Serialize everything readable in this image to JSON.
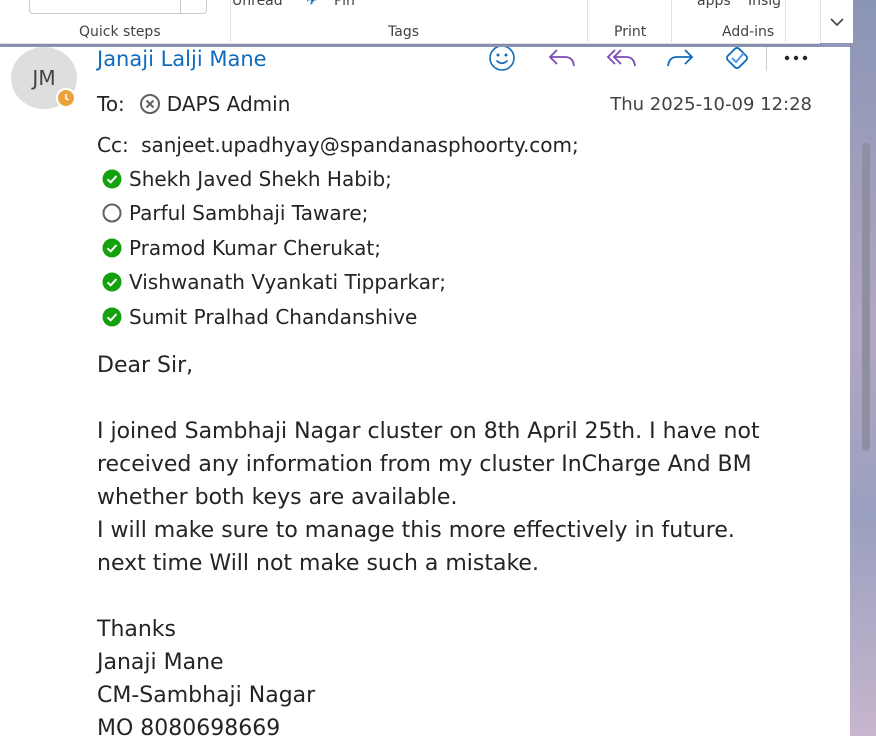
{
  "ribbon": {
    "groups": {
      "quick_steps": "Quick steps",
      "tags": "Tags",
      "print": "Print",
      "addins": "Add-ins"
    },
    "fragments": {
      "unread": "Unread",
      "pin": "Pin",
      "apps": "apps",
      "insights": "Insig"
    },
    "collapse_icon": "chevron-down-icon"
  },
  "message": {
    "avatar_initials": "JM",
    "presence": "away",
    "sender": "Janaji Lalji Mane",
    "to_label": "To:",
    "to_recipient": "DAPS Admin",
    "date": "Thu 2025-10-09 12:28",
    "cc_label": "Cc:",
    "cc_first": "sanjeet.upadhyay@spandanasphoorty.com;",
    "cc_recipients": [
      {
        "name": "Shekh Javed Shekh Habib;",
        "status": "available"
      },
      {
        "name": "Parful Sambhaji Taware;",
        "status": "offline"
      },
      {
        "name": "Pramod Kumar Cherukat;",
        "status": "available"
      },
      {
        "name": "Vishwanath Vyankati Tipparkar;",
        "status": "available"
      },
      {
        "name": "Sumit Pralhad Chandanshive",
        "status": "available"
      }
    ],
    "actions": [
      "emoji-icon",
      "reply-icon",
      "reply-all-icon",
      "forward-icon",
      "teams-share-icon",
      "more-icon"
    ]
  },
  "body": {
    "greeting": "Dear Sir,",
    "lines": [
      "I joined Sambhaji Nagar cluster on 8th April 25th. I have not",
      "received any information from my cluster InCharge And BM",
      "whether both keys are available.",
      "I will make sure to manage this more effectively in future.",
      "next time Will not make such a mistake."
    ],
    "signature": [
      "Thanks",
      "Janaji Mane",
      "CM-Sambhaji Nagar",
      "MO 8080698669"
    ]
  },
  "colors": {
    "accent": "#0f6cbd",
    "action_purple": "#7a4bb5",
    "presence_available": "#13a10e",
    "presence_away": "#e9a33a"
  }
}
